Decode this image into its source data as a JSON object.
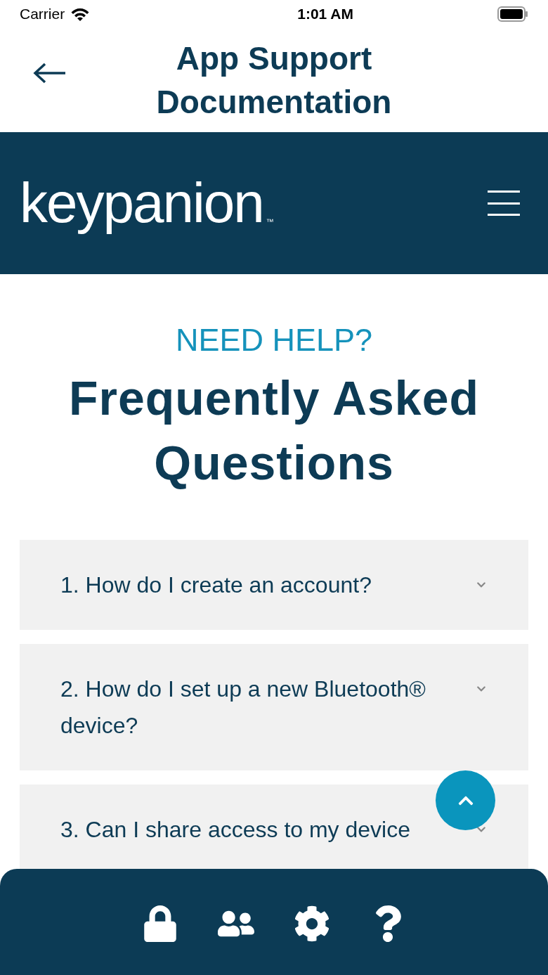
{
  "status_bar": {
    "carrier": "Carrier",
    "time": "1:01 AM"
  },
  "nav_bar": {
    "title": "App Support Documentation"
  },
  "site_header": {
    "logo": "keypanion",
    "trademark": "™"
  },
  "hero": {
    "eyebrow": "NEED HELP?",
    "heading": "Frequently Asked Questions"
  },
  "faq": [
    {
      "question": "1. How do I create an account?",
      "expanded": false
    },
    {
      "question": "2. How do I set up a new Bluetooth® device?",
      "expanded": false
    },
    {
      "question": "3. Can I share access to my device",
      "expanded": false
    }
  ],
  "tab_bar": {
    "items": [
      {
        "kind": "lock"
      },
      {
        "kind": "people"
      },
      {
        "kind": "settings"
      },
      {
        "kind": "help"
      }
    ]
  }
}
